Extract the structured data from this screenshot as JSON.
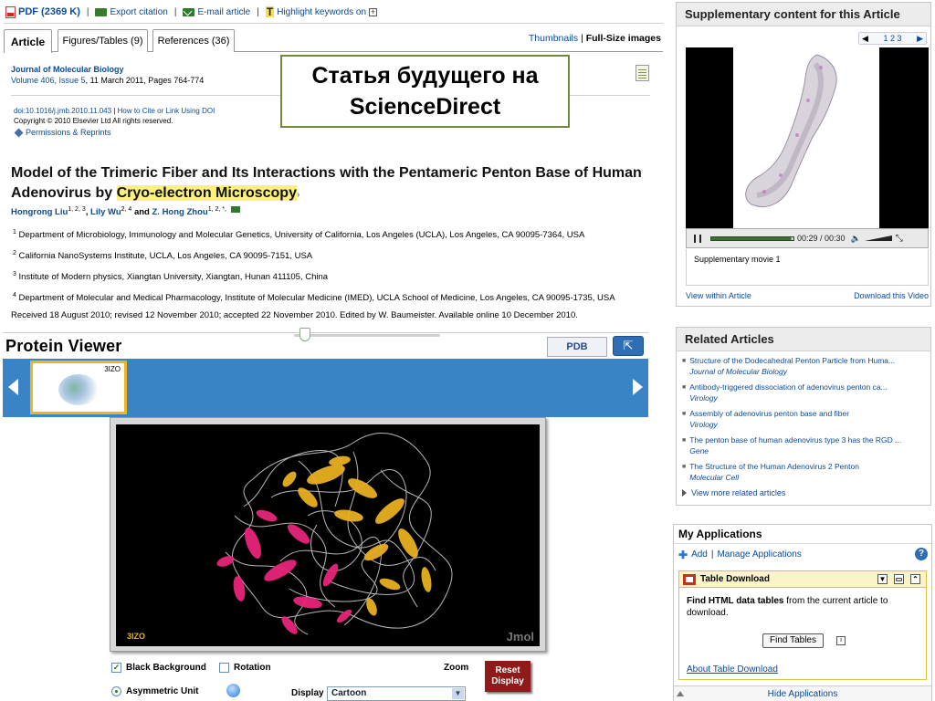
{
  "toolbar": {
    "pdf_label": "PDF (2369 K)",
    "export_label": "Export citation",
    "email_label": "E-mail article",
    "highlight_label": "Highlight keywords on",
    "highlight_icon": "T"
  },
  "tabs": {
    "article": "Article",
    "figures": "Figures/Tables (9)",
    "references": "References (36)",
    "thumbnails": "Thumbnails",
    "fullsize": "Full-Size images",
    "sep": "|"
  },
  "journal": {
    "name": "Journal of Molecular Biology",
    "volume_link": "Volume 406, Issue 5",
    "details": ", 11 March 2011, Pages 764-774"
  },
  "doi": {
    "doi_link": "doi:10.1016/j.jmb.2010.11.043",
    "sep": "|",
    "cite_link": "How to Cite or Link Using DOI",
    "copyright": "Copyright © 2010 Elsevier Ltd All rights reserved.",
    "permissions": "Permissions & Reprints"
  },
  "callout": "Статья будущего на ScienceDirect",
  "article": {
    "title_pre": "Model of the Trimeric Fiber and Its Interactions with the Pentameric Penton Base of Human Adenovirus by ",
    "title_highlight": "Cryo-electron Microscopy",
    "title_arrow": "›",
    "authors": [
      {
        "name": "Hongrong Liu",
        "sup": "1, 2, 3"
      },
      {
        "name": "Lily Wu",
        "sup": "2, 4"
      },
      {
        "name": "Z. Hong Zhou",
        "sup": "1, 2, ",
        "extra": "*, "
      }
    ],
    "and": "and",
    "affiliations": [
      {
        "n": "1",
        "text": "Department of Microbiology, Immunology and Molecular Genetics, University of California, Los Angeles (UCLA), Los Angeles, CA 90095-7364, USA"
      },
      {
        "n": "2",
        "text": "California NanoSystems Institute, UCLA, Los Angeles, CA 90095-7151, USA"
      },
      {
        "n": "3",
        "text": "Institute of Modern physics, Xiangtan University, Xiangtan, Hunan 411105, China"
      },
      {
        "n": "4",
        "text": "Department of Molecular and Medical Pharmacology, Institute of Molecular Medicine (IMED), UCLA School of Medicine, Los Angeles, CA 90095-1735, USA"
      }
    ],
    "history": "Received 18 August 2010;  revised 12 November 2010;  accepted 22 November 2010.  Edited by W. Baumeister.  Available online 10 December 2010."
  },
  "protein_viewer": {
    "title": "Protein Viewer",
    "pdb_logo": "PDB",
    "ext_icon": "⇱",
    "thumb_label": "3IZO",
    "jmol_id": "3IZO",
    "jmol_brand": "Jmol",
    "black_bg_label": "Black Background",
    "black_bg_checked": true,
    "rotation_label": "Rotation",
    "rotation_checked": false,
    "zoom_label": "Zoom",
    "reset_label": "Reset Display",
    "asym_label": "Asymmetric Unit",
    "display_label": "Display",
    "display_value": "Cartoon"
  },
  "supplementary": {
    "header": "Supplementary content for this Article",
    "pages": [
      "1",
      "2",
      "3"
    ],
    "time": "00:29 / 00:30",
    "progress": 0.97,
    "caption": "Supplementary movie 1",
    "view_link": "View within Article",
    "download_link": "Download this Video"
  },
  "related": {
    "header": "Related Articles",
    "items": [
      {
        "title": "Structure of the Dodecahedral Penton Particle from Huma...",
        "source": "Journal of Molecular Biology"
      },
      {
        "title": "Antibody-triggered dissociation of adenovirus penton ca...",
        "source": "Virology"
      },
      {
        "title": "Assembly of adenovirus penton base and fiber",
        "source": "Virology"
      },
      {
        "title": "The penton base of human adenovirus type 3 has the RGD ...",
        "source": "Gene"
      },
      {
        "title": "The Structure of the Human Adenovirus 2 Penton",
        "source": "Molecular Cell"
      }
    ],
    "more": "View more related articles"
  },
  "myapps": {
    "header": "My Applications",
    "add": "Add",
    "sep": "|",
    "manage": "Manage Applications",
    "help": "?",
    "td_title": "Table Download",
    "td_body_bold": "Find HTML data tables",
    "td_body_rest": " from the current article to download.",
    "find_button": "Find Tables",
    "about": "About Table Download",
    "hide": "Hide Applications"
  },
  "colors": {
    "link": "#0a4a9a",
    "strip_blue": "#3a83c6",
    "callout_border": "#6f8b3a",
    "reset_red": "#8f1a1a",
    "highlight": "#fbf17a"
  }
}
